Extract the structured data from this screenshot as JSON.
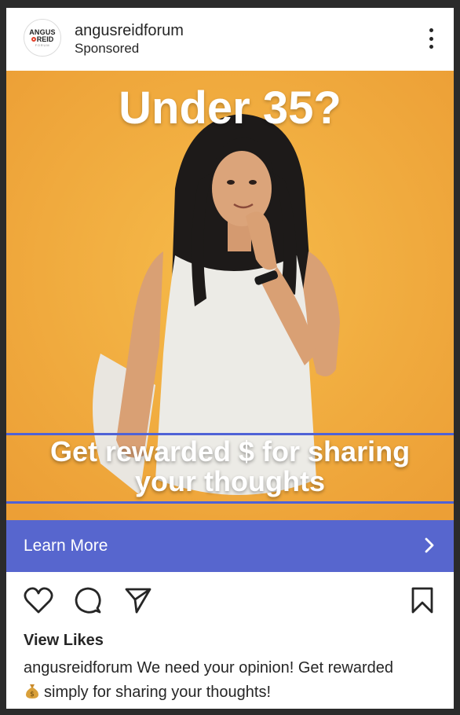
{
  "post": {
    "username": "angusreidforum",
    "sponsored": "Sponsored",
    "avatar": {
      "line1": "ANGUS",
      "line2": "REID",
      "line3": "FORUM"
    }
  },
  "ad": {
    "headline": "Under 35?",
    "subtext_line1": "Get rewarded $ for sharing",
    "subtext_line2": "your thoughts",
    "background_color": "#f3ae3f",
    "accent_line_color": "#4f62d6"
  },
  "cta": {
    "label": "Learn More",
    "color": "#5766ce"
  },
  "actions": {
    "icons": [
      "heart-icon",
      "comment-icon",
      "share-icon",
      "bookmark-icon"
    ]
  },
  "likes_label": "View Likes",
  "caption": {
    "user": "angusreidforum",
    "text_part1": "We need your opinion! Get rewarded",
    "text_part2": "simply for sharing your thoughts!",
    "emoji": "money-bag-icon"
  }
}
